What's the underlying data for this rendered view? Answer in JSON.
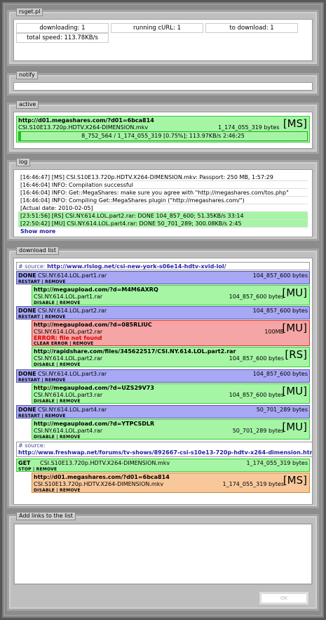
{
  "header": {
    "title": "rsget.pl"
  },
  "status": {
    "downloading": "downloading: 1",
    "running": "running cURL: 1",
    "todownload": "to download: 1",
    "speed": "total speed: 113.78KB/s"
  },
  "notify": {
    "title": "notify"
  },
  "active": {
    "title": "active",
    "url": "http://d01.megashares.com/?d01=6bca814",
    "file": "CSI.S10E13.720p.HDTV.X264-DIMENSION.mkv",
    "size": "1_174_055_319 bytes",
    "tag": "[MS]",
    "progress_text": "8_752_564 / 1_174_055_319 [0.75%]; 113.97KB/s 2:46:25",
    "progress": 0.0075
  },
  "log": {
    "title": "log",
    "lines": [
      "[16:46:47] [MS] CSI.S10E13.720p.HDTV.X264-DIMENSION.mkv: Passport: 250 MB, 1:57:29",
      "[16:46:04] INFO: Compilation successful",
      "[16:46:04] INFO: Get::MegaShares: make sure you agree with \"http://megashares.com/tos.php\"",
      "[16:46:04] INFO: Compiling Get::MegaShares plugin (\"http://megashares.com/\")",
      "[Actual date: 2010-02-05]",
      "[23:51:56] [RS] CSI.NY.614.LOL.part2.rar: DONE 104_857_600; 51.35KB/s 33:14",
      "[22:50:42] [MU] CSI.NY.614.LOL.part4.rar: DONE 50_701_289; 300.08KB/s 2:45"
    ],
    "show_more": "Show more"
  },
  "dl": {
    "title": "download list",
    "source_label": "# source:",
    "source1": "http://www.rlslog.net/csi-new-york-s06e14-hdtv-xvid-lol/",
    "source2": "http://www.freshwap.net/forums/tv-shows/892667-csi-s10e13-720p-hdtv-x264-dimension.html",
    "done": "DONE",
    "get": "GET",
    "restart_remove": "RESTART | REMOVE",
    "disable_remove": "DISABLE | REMOVE",
    "stop_remove": "STOP | REMOVE",
    "clear_remove": "CLEAR ERROR | REMOVE",
    "f1": "CSI.NY.614.LOL.part1.rar",
    "s1": "104_857_600 bytes",
    "u1": "http://megaupload.com/?d=M4M6AXRQ",
    "t_mu": "[MU]",
    "t_rs": "[RS]",
    "t_ms": "[MS]",
    "f2": "CSI.NY.614.LOL.part2.rar",
    "s2": "104_857_600 bytes",
    "u2": "http://megaupload.com/?d=085RLIUC",
    "s2b": "100MB",
    "err": "ERROR: file not found",
    "u2b": "http://rapidshare.com/files/345622517/CSI.NY.614.LOL.part2.rar",
    "f3": "CSI.NY.614.LOL.part3.rar",
    "s3": "104_857_600 bytes",
    "u3": "http://megaupload.com/?d=UZS29V73",
    "f4": "CSI.NY.614.LOL.part4.rar",
    "s4": "50_701_289 bytes",
    "u4": "http://megaupload.com/?d=YTPCSDLR",
    "f5": "CSI.S10E13.720p.HDTV.X264-DIMENSION.mkv",
    "s5": "1_174_055_319 bytes",
    "u5": "http://d01.megashares.com/?d01=6bca814",
    "f5b": "CSI.S10E13.720p.HDTV.X264-DIMENSION.mkv"
  },
  "add": {
    "title": "Add links to the list",
    "ok": "OK"
  }
}
